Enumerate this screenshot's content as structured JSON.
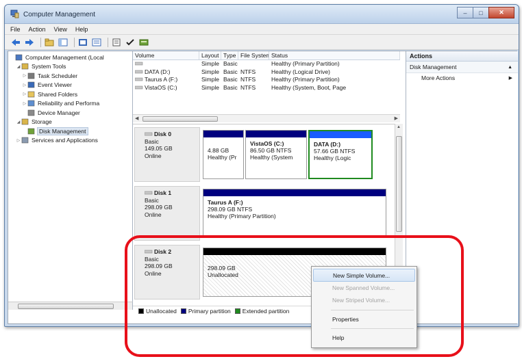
{
  "window": {
    "title": "Computer Management"
  },
  "menu": [
    "File",
    "Action",
    "View",
    "Help"
  ],
  "tree": [
    {
      "label": "Computer Management (Local",
      "level": 0,
      "arrow": ""
    },
    {
      "label": "System Tools",
      "level": 1,
      "arrow": "◢"
    },
    {
      "label": "Task Scheduler",
      "level": 2,
      "arrow": "▷"
    },
    {
      "label": "Event Viewer",
      "level": 2,
      "arrow": "▷"
    },
    {
      "label": "Shared Folders",
      "level": 2,
      "arrow": "▷"
    },
    {
      "label": "Reliability and Performa",
      "level": 2,
      "arrow": "▷"
    },
    {
      "label": "Device Manager",
      "level": 2,
      "arrow": ""
    },
    {
      "label": "Storage",
      "level": 1,
      "arrow": "◢"
    },
    {
      "label": "Disk Management",
      "level": 2,
      "arrow": ""
    },
    {
      "label": "Services and Applications",
      "level": 1,
      "arrow": "▷"
    }
  ],
  "volume_table": {
    "headers": [
      "Volume",
      "Layout",
      "Type",
      "File System",
      "Status"
    ],
    "rows": [
      [
        "",
        "Simple",
        "Basic",
        "",
        "Healthy (Primary Partition)"
      ],
      [
        "DATA (D:)",
        "Simple",
        "Basic",
        "NTFS",
        "Healthy (Logical Drive)"
      ],
      [
        "Taurus A (F:)",
        "Simple",
        "Basic",
        "NTFS",
        "Healthy (Primary Partition)"
      ],
      [
        "VistaOS (C:)",
        "Simple",
        "Basic",
        "NTFS",
        "Healthy (System, Boot, Page"
      ]
    ]
  },
  "disks": [
    {
      "name": "Disk 0",
      "type": "Basic",
      "size": "149.05 GB",
      "status": "Online",
      "partitions": [
        {
          "title": "",
          "line1": "4.88 GB",
          "line2": "Healthy (Pr",
          "bar": "#00007f",
          "extended": false,
          "unalloc": false
        },
        {
          "title": "VistaOS (C:)",
          "line1": "86.50 GB NTFS",
          "line2": "Healthy (System",
          "bar": "#00007f",
          "extended": false,
          "unalloc": false
        },
        {
          "title": "DATA (D:)",
          "line1": "57.66 GB NTFS",
          "line2": "Healthy (Logic",
          "bar": "#1a5cff",
          "extended": true,
          "unalloc": false
        }
      ]
    },
    {
      "name": "Disk 1",
      "type": "Basic",
      "size": "298.09 GB",
      "status": "Online",
      "partitions": [
        {
          "title": "Taurus A (F:)",
          "line1": "298.09 GB NTFS",
          "line2": "Healthy (Primary Partition)",
          "bar": "#00007f",
          "extended": false,
          "unalloc": false
        }
      ]
    },
    {
      "name": "Disk 2",
      "type": "Basic",
      "size": "298.09 GB",
      "status": "Online",
      "partitions": [
        {
          "title": "",
          "line1": "298.09 GB",
          "line2": "Unallocated",
          "bar": "#000000",
          "extended": false,
          "unalloc": true
        }
      ]
    }
  ],
  "legend": [
    {
      "label": "Unallocated",
      "color": "#000000"
    },
    {
      "label": "Primary partition",
      "color": "#00007f"
    },
    {
      "label": "Extended partition",
      "color": "#1f8a1f"
    }
  ],
  "actions": {
    "header": "Actions",
    "section": "Disk Management",
    "section_arrow": "▲",
    "more": "More Actions",
    "more_arrow": "▶"
  },
  "context_menu": [
    {
      "label": "New Simple Volume...",
      "state": "hover"
    },
    {
      "label": "New Spanned Volume...",
      "state": "disabled"
    },
    {
      "label": "New Striped Volume...",
      "state": "disabled"
    },
    {
      "sep": true
    },
    {
      "label": "Properties",
      "state": "normal"
    },
    {
      "sep": true
    },
    {
      "label": "Help",
      "state": "normal"
    }
  ],
  "colors": {
    "highlight": "#e8101a",
    "primary": "#00007f",
    "logical": "#1a5cff",
    "extended": "#1f8a1f"
  }
}
